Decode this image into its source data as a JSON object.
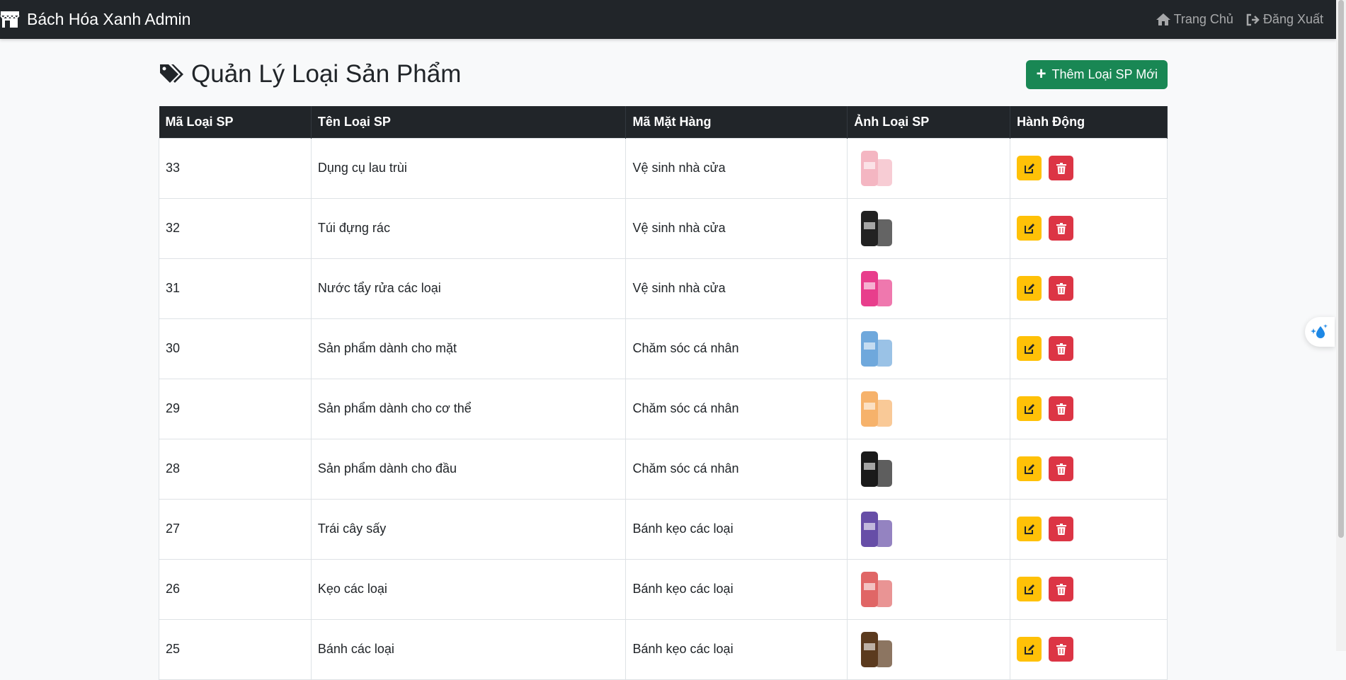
{
  "navbar": {
    "brand": "Bách Hóa Xanh Admin",
    "brand_icon": "store-icon",
    "links": [
      {
        "label": "Trang Chủ",
        "icon": "home-icon"
      },
      {
        "label": "Đăng Xuất",
        "icon": "logout-icon"
      }
    ]
  },
  "page": {
    "title": "Quản Lý Loại Sản Phẩm",
    "title_icon": "tags-icon",
    "add_button": "Thêm Loại SP Mới"
  },
  "table": {
    "headers": [
      "Mã Loại SP",
      "Tên Loại SP",
      "Mã Mặt Hàng",
      "Ảnh Loại SP",
      "Hành Động"
    ],
    "rows": [
      {
        "id": "33",
        "name": "Dụng cụ lau trùi",
        "group": "Vệ sinh nhà cửa",
        "image": "gloves-sponge",
        "color": "#f4b6c2"
      },
      {
        "id": "32",
        "name": "Túi đựng rác",
        "group": "Vệ sinh nhà cửa",
        "image": "trash-bags",
        "color": "#222222"
      },
      {
        "id": "31",
        "name": "Nước tẩy rửa các loại",
        "group": "Vệ sinh nhà cửa",
        "image": "cleaner-bottle",
        "color": "#e83e8c"
      },
      {
        "id": "30",
        "name": "Sản phẩm dành cho mặt",
        "group": "Chăm sóc cá nhân",
        "image": "face-products",
        "color": "#6fa8dc"
      },
      {
        "id": "29",
        "name": "Sản phẩm dành cho cơ thể",
        "group": "Chăm sóc cá nhân",
        "image": "body-products",
        "color": "#f6b26b"
      },
      {
        "id": "28",
        "name": "Sản phẩm dành cho đầu",
        "group": "Chăm sóc cá nhân",
        "image": "hair-products",
        "color": "#1a1a1a"
      },
      {
        "id": "27",
        "name": "Trái cây sấy",
        "group": "Bánh kẹo các loại",
        "image": "dried-fruit",
        "color": "#674ea7"
      },
      {
        "id": "26",
        "name": "Kẹo các loại",
        "group": "Bánh kẹo các loại",
        "image": "candy",
        "color": "#e06666"
      },
      {
        "id": "25",
        "name": "Bánh các loại",
        "group": "Bánh kẹo các loại",
        "image": "cookies",
        "color": "#5b3a1e"
      }
    ],
    "edit_icon": "edit-icon",
    "delete_icon": "trash-icon"
  },
  "colors": {
    "navbar": "#212529",
    "success": "#198754",
    "warning": "#ffc107",
    "danger": "#dc3545"
  }
}
